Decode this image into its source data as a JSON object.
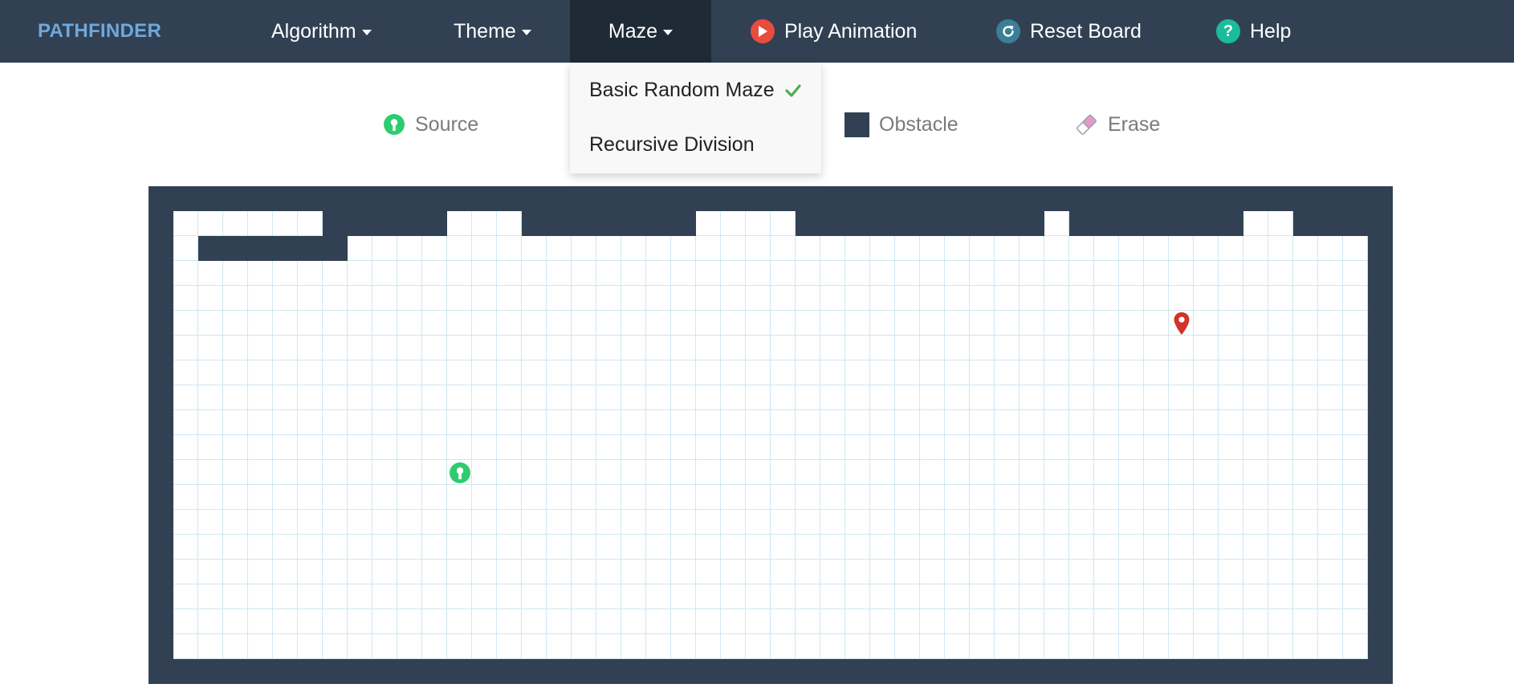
{
  "app": {
    "brand": "PATHFINDER"
  },
  "nav": {
    "algorithm": "Algorithm",
    "theme": "Theme",
    "maze": "Maze",
    "play": "Play Animation",
    "reset": "Reset Board",
    "help": "Help"
  },
  "maze_menu": {
    "items": [
      {
        "label": "Basic Random Maze",
        "selected": true
      },
      {
        "label": "Recursive Division",
        "selected": false
      }
    ]
  },
  "legend": {
    "source": "Source",
    "obstacle": "Obstacle",
    "erase": "Erase"
  },
  "colors": {
    "navbar": "#314153",
    "brand": "#6fa8dc",
    "wall": "#314153",
    "source": "#2ecc71",
    "target": "#d0342c",
    "play_icon": "#e74c3c",
    "reset_icon": "#3a7f95",
    "help_icon": "#1abc9c",
    "check": "#4caf50"
  },
  "icons": {
    "play": "play-circle-icon",
    "reset": "refresh-icon",
    "help": "question-circle-icon",
    "source": "source-marker-icon",
    "target": "map-pin-icon",
    "erase": "eraser-icon"
  },
  "grid": {
    "cols": 48,
    "rows": 18,
    "source": {
      "row": 10,
      "col": 11
    },
    "target": {
      "row": 4,
      "col": 40
    },
    "walls": [
      "000000111110001111111000011111111110111111100111",
      "011111100000000000000000000000000000000000000000",
      "000000000000000000000000000000000000000000000000",
      "000000000000000000000000000000000000000000000000",
      "000000000000000000000000000000000000000000000000",
      "000000000000000000000000000000000000000000000000",
      "000000000000000000000000000000000000000000000000",
      "000000000000000000000000000000000000000000000000",
      "000000000000000000000000000000000000000000000000",
      "000000000000000000000000000000000000000000000000",
      "000000000000000000000000000000000000000000000000",
      "000000000000000000000000000000000000000000000000",
      "000000000000000000000000000000000000000000000000",
      "000000000000000000000000000000000000000000000000",
      "000000000000000000000000000000000000000000000000",
      "000000000000000000000000000000000000000000000000",
      "000000000000000000000000000000000000000000000000",
      "000000000000000000000000000000000000000000000000"
    ]
  }
}
